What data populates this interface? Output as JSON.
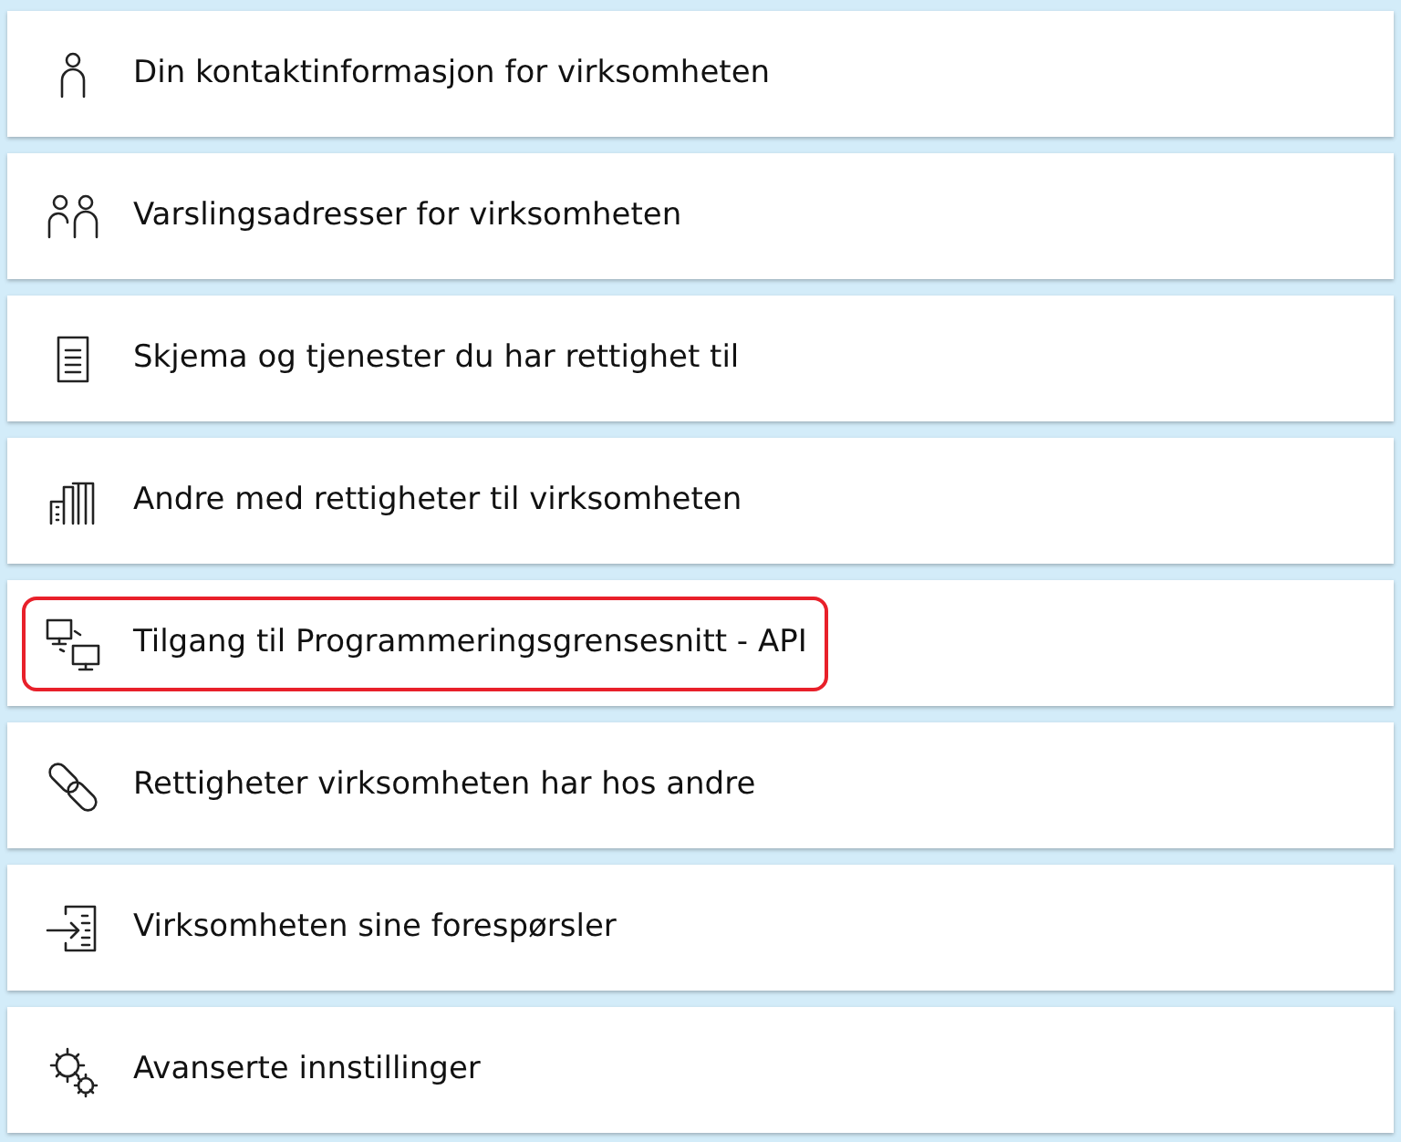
{
  "menu_items": [
    {
      "label": "Din kontaktinformasjon for virksomheten",
      "kind": "person",
      "highlighted": false
    },
    {
      "label": "Varslingsadresser for virksomheten",
      "kind": "people",
      "highlighted": false
    },
    {
      "label": "Skjema og tjenester du har rettighet til",
      "kind": "document",
      "highlighted": false
    },
    {
      "label": "Andre med rettigheter til virksomheten",
      "kind": "building",
      "highlighted": false
    },
    {
      "label": "Tilgang til Programmeringsgrensesnitt - API",
      "kind": "computers",
      "highlighted": true
    },
    {
      "label": "Rettigheter virksomheten har hos andre",
      "kind": "link",
      "highlighted": false
    },
    {
      "label": "Virksomheten sine forespørsler",
      "kind": "inbox",
      "highlighted": false
    },
    {
      "label": "Avanserte innstillinger",
      "kind": "gears",
      "highlighted": false
    }
  ]
}
